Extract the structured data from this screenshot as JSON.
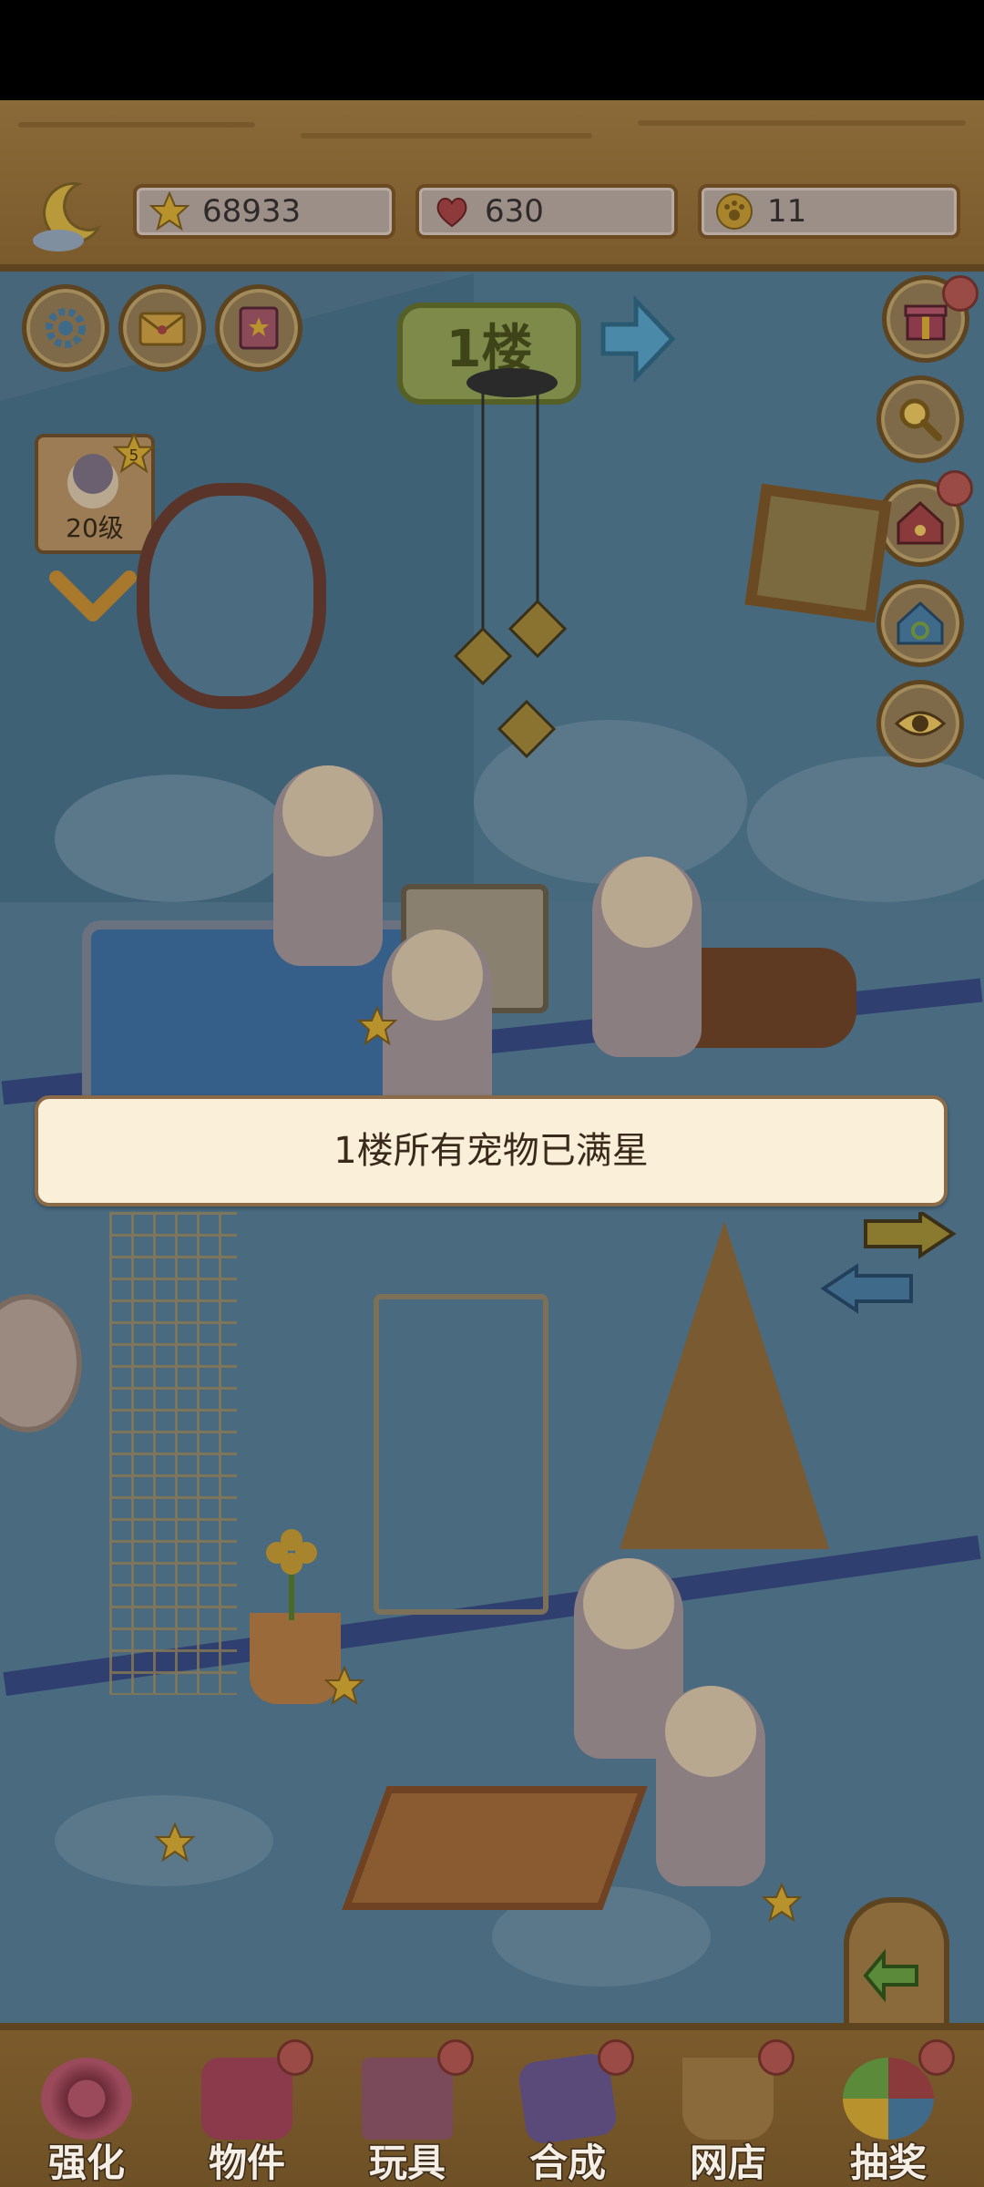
{
  "resources": {
    "stars": "68933",
    "hearts": "630",
    "coins": "11"
  },
  "floor": {
    "label": "1楼"
  },
  "level_card": {
    "level": "20级",
    "stars": "5"
  },
  "toast": {
    "message": "1楼所有宠物已满星"
  },
  "nav": {
    "tabs": [
      {
        "label": "强化",
        "icon": "swirl-candy-icon"
      },
      {
        "label": "物件",
        "icon": "piano-icon"
      },
      {
        "label": "玩具",
        "icon": "toy-house-icon"
      },
      {
        "label": "合成",
        "icon": "cards-icon"
      },
      {
        "label": "网店",
        "icon": "basket-icon"
      },
      {
        "label": "抽奖",
        "icon": "wheel-icon"
      }
    ]
  },
  "colors": {
    "wood": "#7b5b2c",
    "toast_bg": "#faefd8",
    "badge_red": "#9a4b45"
  }
}
